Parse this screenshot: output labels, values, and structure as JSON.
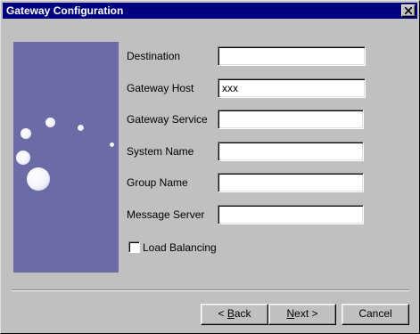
{
  "window": {
    "title": "Gateway Configuration"
  },
  "fields": [
    {
      "label": "Destination",
      "value": ""
    },
    {
      "label": "Gateway Host",
      "value": "xxx"
    },
    {
      "label": "Gateway Service",
      "value": ""
    },
    {
      "label": "System Name",
      "value": ""
    },
    {
      "label": "Group Name",
      "value": ""
    },
    {
      "label": "Message Server",
      "value": ""
    }
  ],
  "load_balancing": {
    "label": "Load Balancing",
    "checked": false
  },
  "buttons": {
    "back": {
      "mnemonic": "< ",
      "underlined": "B",
      "rest": "ack"
    },
    "next": {
      "mnemonic": "",
      "underlined": "N",
      "rest": "ext >"
    },
    "cancel": {
      "label": "Cancel"
    }
  },
  "colors": {
    "titlebar": "#000080",
    "side_panel": "#6b6ba5",
    "dialog_bg": "#c0c0c0"
  },
  "icons": {
    "close": "close-icon"
  }
}
